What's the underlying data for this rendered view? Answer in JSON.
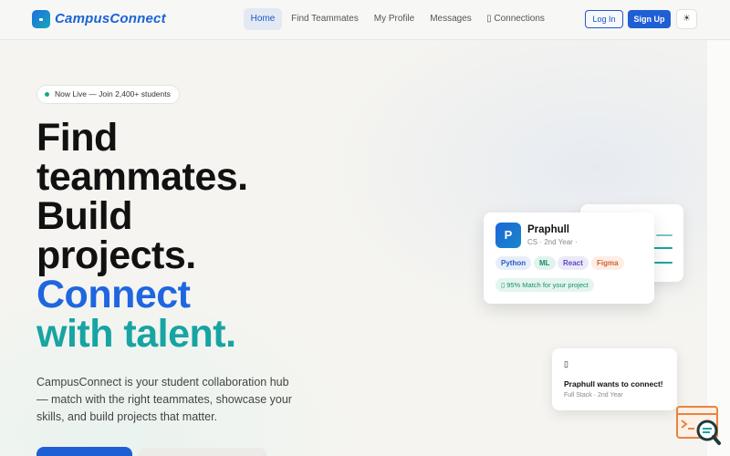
{
  "nav": {
    "logo_text": "CampusConnect",
    "links": {
      "home": "Home",
      "find": "Find Teammates",
      "profile": "My Profile",
      "messages": "Messages",
      "connections": "▯ Connections"
    },
    "login": "Log In",
    "signup": "Sign Up",
    "theme_icon": "☀"
  },
  "hero": {
    "pill": "Now Live — Join 2,400+ students",
    "lines": [
      "Find",
      "teammates.",
      "Build",
      "projects.",
      "Connect",
      "with talent."
    ],
    "description": "CampusConnect is your student collaboration hub — match with the right teammates, showcase your skills, and build projects that matter."
  },
  "card": {
    "avatar_letter": "P",
    "name": "Praphull",
    "subtitle": "CS · 2nd Year ·",
    "tags": [
      "Python",
      "ML",
      "React",
      "Figma"
    ],
    "match": "▯ 95% Match for your project"
  },
  "notification": {
    "icon": "▯",
    "title": "Praphull wants to connect!",
    "subtitle": "Full Stack · 2nd Year"
  },
  "colors": {
    "brand_blue": "#1f5fd6",
    "teal": "#17a4a2",
    "live_green": "#19a97b"
  }
}
